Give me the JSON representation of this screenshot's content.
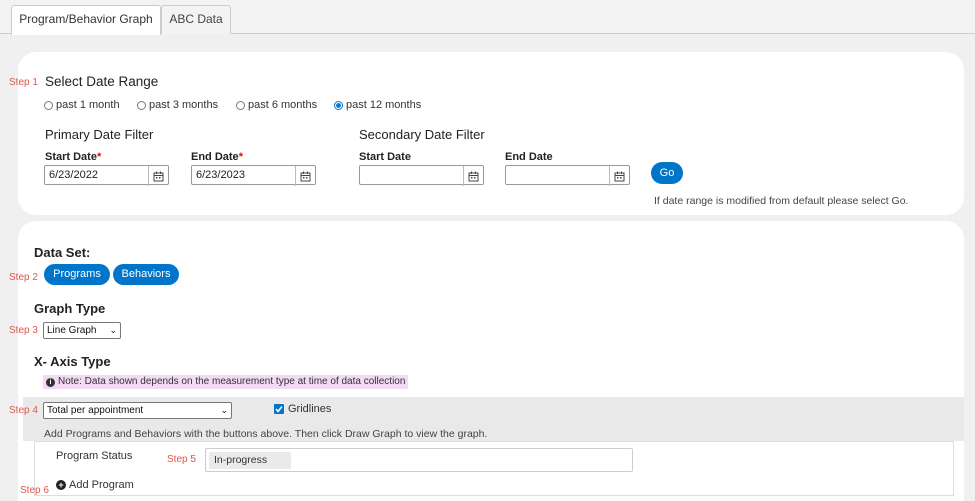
{
  "tabs": [
    {
      "label": "Program/Behavior Graph"
    },
    {
      "label": "ABC Data"
    }
  ],
  "step1": {
    "step_label": "Step 1",
    "title": "Select Date Range",
    "radios": [
      {
        "label": "past 1 month",
        "checked": false
      },
      {
        "label": "past 3 months",
        "checked": false
      },
      {
        "label": "past 6 months",
        "checked": false
      },
      {
        "label": "past 12 months",
        "checked": true
      }
    ],
    "primary": {
      "title": "Primary Date Filter",
      "start_label": "Start Date",
      "start_value": "6/23/2022",
      "end_label": "End Date",
      "end_value": "6/23/2023",
      "required_mark": "*"
    },
    "secondary": {
      "title": "Secondary Date Filter",
      "start_label": "Start Date",
      "start_value": "",
      "end_label": "End Date",
      "end_value": ""
    },
    "go_label": "Go",
    "hint": "If date range is modified from default please select Go."
  },
  "dataset": {
    "title": "Data Set:",
    "step_label": "Step 2",
    "buttons": [
      "Programs",
      "Behaviors"
    ]
  },
  "graph_type": {
    "title": "Graph Type",
    "step_label": "Step 3",
    "selected": "Line Graph"
  },
  "x_axis": {
    "title": "X- Axis Type",
    "note": "Note: Data shown depends on the measurement type at time of data collection",
    "step_label": "Step 4",
    "selected": "Total per appointment",
    "gridlines_label": "Gridlines",
    "gridlines_checked": true,
    "help": "Add Programs and Behaviors with the buttons above. Then click Draw Graph to view the graph."
  },
  "status": {
    "label": "Program Status",
    "step_label": "Step 5",
    "chip": "In-progress"
  },
  "add_program": {
    "step_label": "Step 6",
    "label": "Add Program"
  },
  "colors": {
    "accent": "#0075c9",
    "step": "#e0574a",
    "note_bg": "#f3d9f3"
  }
}
